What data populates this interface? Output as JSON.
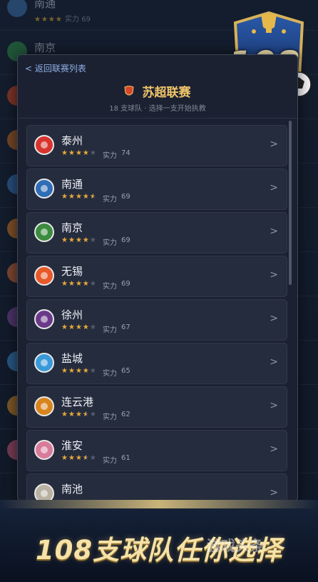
{
  "colors": {
    "accent_gold": "#f1c56a",
    "star": "#e9a93a",
    "panel": "#1b2131",
    "row": "#252c3d"
  },
  "background": {
    "rows": [
      {
        "name": "南通",
        "stars": "★★★★",
        "power_label": "实力",
        "power": "69",
        "color": "#3a6ea8"
      },
      {
        "name": "南京",
        "stars": "",
        "power_label": "",
        "power": "",
        "color": "#2f8a4a"
      },
      {
        "name": "",
        "stars": "",
        "power_label": "",
        "power": "",
        "color": "#d04a2a"
      },
      {
        "name": "",
        "stars": "",
        "power_label": "",
        "power": "",
        "color": "#c06a2a"
      },
      {
        "name": "",
        "stars": "",
        "power_label": "",
        "power": "",
        "color": "#3a78c0"
      },
      {
        "name": "",
        "stars": "",
        "power_label": "",
        "power": "",
        "color": "#d07a2a"
      },
      {
        "name": "",
        "stars": "",
        "power_label": "",
        "power": "",
        "color": "#d06a3a"
      },
      {
        "name": "",
        "stars": "",
        "power_label": "",
        "power": "",
        "color": "#7a4a9a"
      },
      {
        "name": "",
        "stars": "",
        "power_label": "",
        "power": "",
        "color": "#3a8ac8"
      },
      {
        "name": "",
        "stars": "",
        "power_label": "",
        "power": "",
        "color": "#d08a2a"
      },
      {
        "name": "",
        "stars": "",
        "power_label": "",
        "power": "",
        "color": "#c85a7a"
      }
    ]
  },
  "logo": {
    "text": "108"
  },
  "panel": {
    "back_label": "< 返回联赛列表",
    "league_title": "苏超联赛",
    "league_subtitle": "18 支球队 · 选择一支开始执教",
    "chevron": ">"
  },
  "teams": [
    {
      "name": "泰州",
      "full": 4,
      "half": 0,
      "empty": 1,
      "power_label": "实力",
      "power": "74",
      "color": "#d8342e",
      "icon": "phoenix-icon"
    },
    {
      "name": "南通",
      "full": 4,
      "half": 1,
      "empty": 0,
      "power_label": "实力",
      "power": "69",
      "color": "#2f6db5",
      "icon": "ship-icon"
    },
    {
      "name": "南京",
      "full": 4,
      "half": 0,
      "empty": 1,
      "power_label": "实力",
      "power": "69",
      "color": "#3c8c3f",
      "icon": "emblem-icon"
    },
    {
      "name": "无锡",
      "full": 4,
      "half": 0,
      "empty": 1,
      "power_label": "实力",
      "power": "69",
      "color": "#e8592a",
      "icon": "flower-icon"
    },
    {
      "name": "徐州",
      "full": 4,
      "half": 0,
      "empty": 1,
      "power_label": "实力",
      "power": "67",
      "color": "#6a3a8a",
      "icon": "sword-icon"
    },
    {
      "name": "盐城",
      "full": 4,
      "half": 0,
      "empty": 1,
      "power_label": "实力",
      "power": "65",
      "color": "#3a9ad8",
      "icon": "crane-icon"
    },
    {
      "name": "连云港",
      "full": 3,
      "half": 1,
      "empty": 1,
      "power_label": "实力",
      "power": "62",
      "color": "#d8841e",
      "icon": "monkey-icon"
    },
    {
      "name": "淮安",
      "full": 3,
      "half": 1,
      "empty": 1,
      "power_label": "实力",
      "power": "61",
      "color": "#d87a9a",
      "icon": "statue-icon"
    },
    {
      "name": "南池",
      "full": 0,
      "half": 0,
      "empty": 0,
      "power_label": "",
      "power": "",
      "color": "#b8b2a2",
      "icon": "emblem-icon"
    }
  ],
  "banner": {
    "text": "108支球队任你选择",
    "watermark": "游戏头条"
  }
}
